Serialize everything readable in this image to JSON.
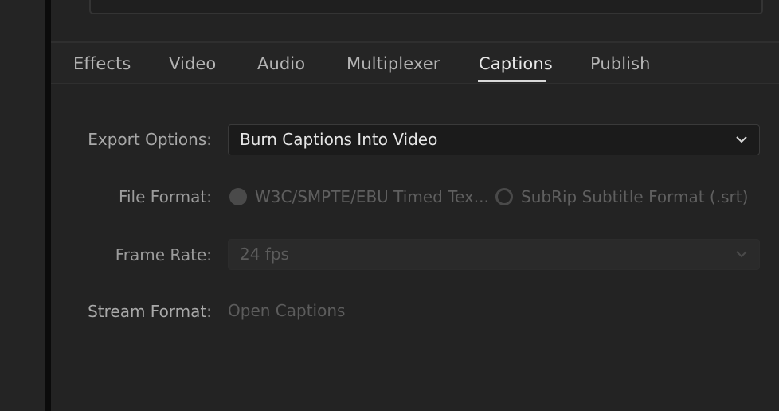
{
  "tabs": [
    {
      "label": "Effects",
      "active": false
    },
    {
      "label": "Video",
      "active": false
    },
    {
      "label": "Audio",
      "active": false
    },
    {
      "label": "Multiplexer",
      "active": false
    },
    {
      "label": "Captions",
      "active": true
    },
    {
      "label": "Publish",
      "active": false
    }
  ],
  "captions": {
    "export_options": {
      "label": "Export Options:",
      "value": "Burn Captions Into Video",
      "icon": "chevron-down-icon"
    },
    "file_format": {
      "label": "File Format:",
      "options": [
        {
          "label": "W3C/SMPTE/EBU Timed Tex...",
          "selected": true
        },
        {
          "label": "SubRip Subtitle Format (.srt)",
          "selected": false
        }
      ]
    },
    "frame_rate": {
      "label": "Frame Rate:",
      "value": "24 fps",
      "icon": "chevron-down-icon"
    },
    "stream_format": {
      "label": "Stream Format:",
      "value": "Open Captions"
    }
  },
  "colors": {
    "background": "#232323",
    "active_tab": "#e9e9e9",
    "inactive_tab": "#b4b4b4",
    "disabled_text": "#5c5c5c"
  }
}
